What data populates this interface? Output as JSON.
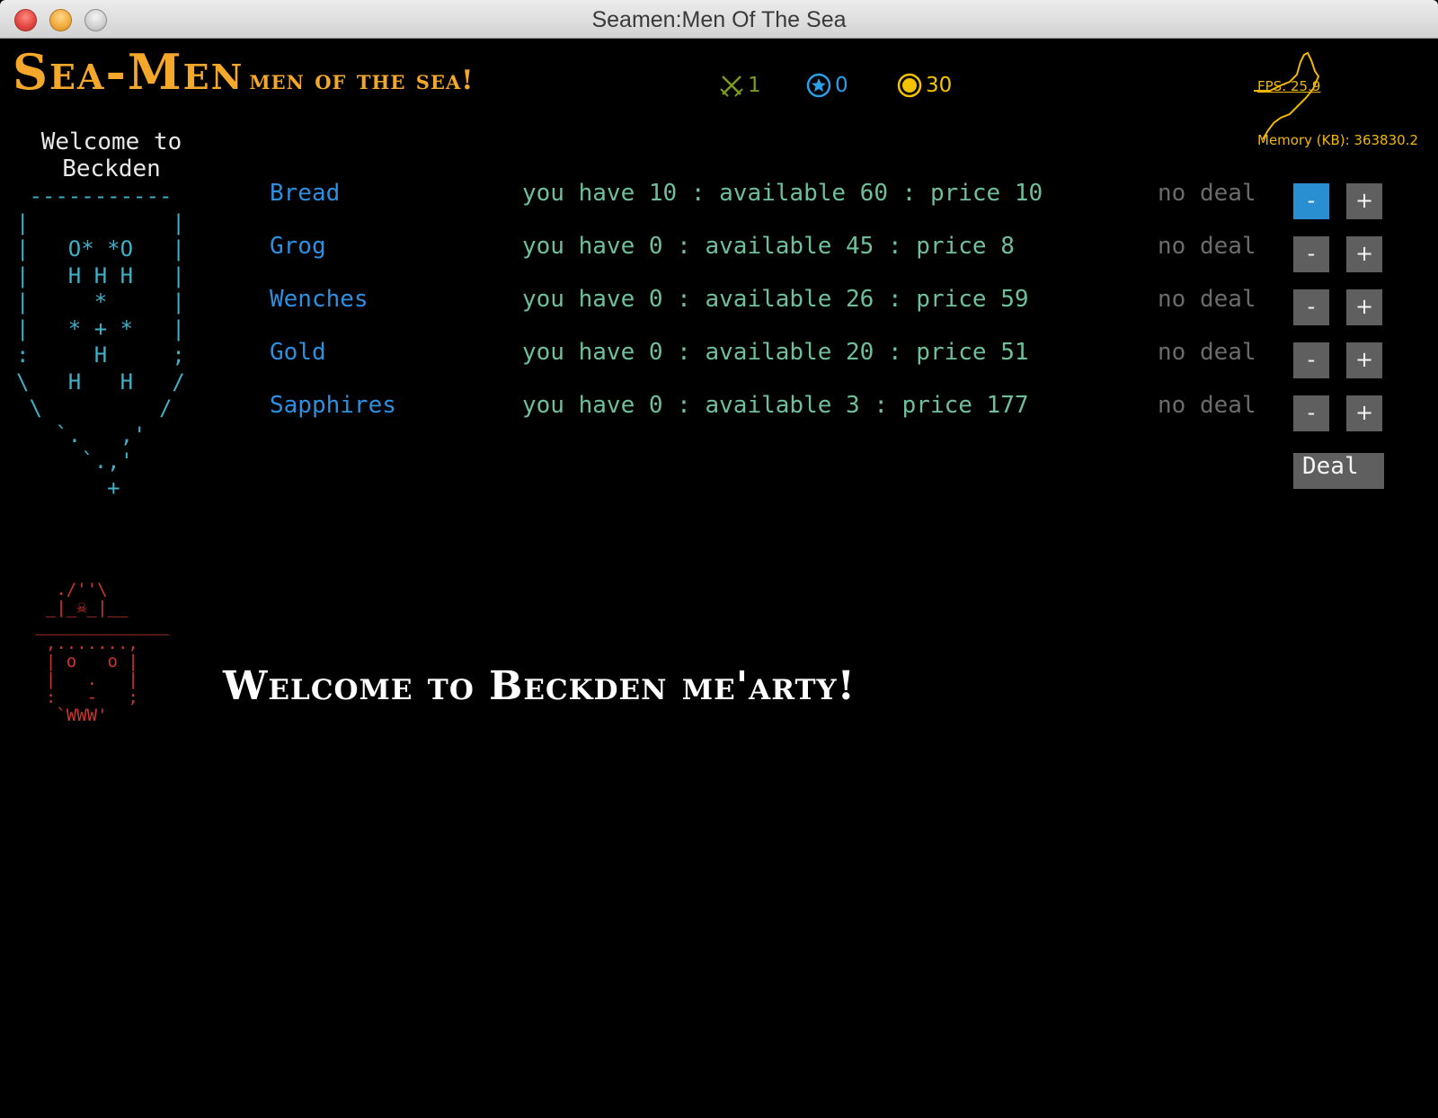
{
  "window": {
    "title": "Seamen:Men Of The Sea"
  },
  "header": {
    "logo_main": "Sea-Men",
    "logo_sub": "men of the sea!",
    "crew_count": "1",
    "reputation": "0",
    "gold": "30",
    "fps_label": "FPS: 25.9",
    "memory_label": "Memory (KB): 363830.2"
  },
  "port": {
    "welcome_line1": "Welcome to",
    "welcome_line2": "Beckden",
    "greeting": "Welcome to Beckden me'arty!"
  },
  "goods": [
    {
      "name": "Bread",
      "info": "you have 10 : available 60 : price 10",
      "deal": "no deal",
      "minus_active": true
    },
    {
      "name": "Grog",
      "info": "you have 0 : available 45 : price 8",
      "deal": "no deal",
      "minus_active": false
    },
    {
      "name": "Wenches",
      "info": "you have 0 : available 26 : price 59",
      "deal": "no deal",
      "minus_active": false
    },
    {
      "name": "Gold",
      "info": "you have 0 : available 20 : price 51",
      "deal": "no deal",
      "minus_active": false
    },
    {
      "name": "Sapphires",
      "info": "you have 0 : available 3 : price 177",
      "deal": "no deal",
      "minus_active": false
    }
  ],
  "buttons": {
    "minus": "-",
    "plus": "+",
    "deal": "Deal"
  },
  "colors": {
    "logo": "#f3a72b",
    "good_name": "#2d8fe0",
    "good_info": "#6fbf9a",
    "active_button": "#2a8fd0",
    "button": "#5f5f5f"
  },
  "icons": {
    "crew": "crossed-swords-icon",
    "reputation": "star-circle-icon",
    "gold": "gold-coin-icon"
  }
}
